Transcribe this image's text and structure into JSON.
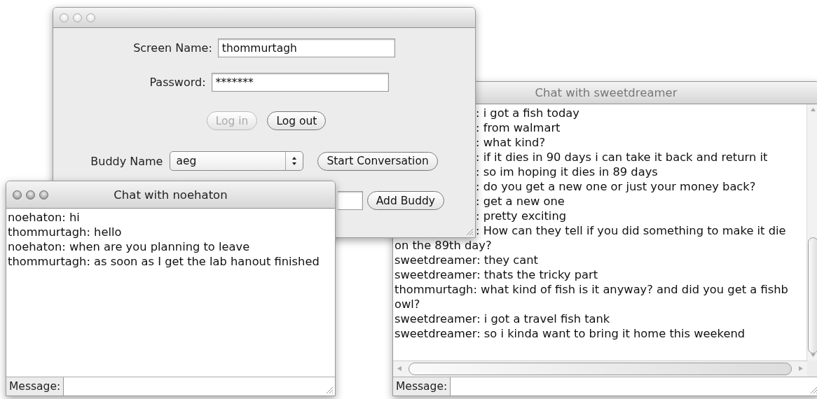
{
  "login_window": {
    "active": false,
    "fields": [
      {
        "label": "Screen Name:",
        "value": "thommurtagh"
      },
      {
        "label": "Password:",
        "value": "*******"
      }
    ],
    "buttons": [
      {
        "label": "Log in",
        "disabled": true
      },
      {
        "label": "Log out",
        "disabled": false
      }
    ],
    "buddy_name": {
      "label": "Buddy Name",
      "value": "aeg"
    },
    "start_button": "Start Conversation",
    "add_buddy_button": "Add Buddy"
  },
  "chat_windows": [
    {
      "title": "Chat with noehaton",
      "active": true,
      "scrollbars": false,
      "message_label": "Message:",
      "lines": [
        {
          "kind": "full",
          "text": "noehaton: hi"
        },
        {
          "kind": "full",
          "text": "thommurtagh: hello"
        },
        {
          "kind": "full",
          "text": "noehaton: when are you planning to leave"
        },
        {
          "kind": "full",
          "text": "thommurtagh: as soon as I get the lab hanout finished"
        }
      ]
    },
    {
      "title": "Chat with sweetdreamer",
      "active": false,
      "scrollbars": true,
      "message_label": "Message:",
      "lines": [
        {
          "kind": "clipped",
          "text": ": i got a fish today"
        },
        {
          "kind": "clipped",
          "text": ": from walmart"
        },
        {
          "kind": "clipped",
          "text": ": what kind?"
        },
        {
          "kind": "clipped",
          "text": ": if it dies in 90 days i can take it back and return it"
        },
        {
          "kind": "clipped",
          "text": ": so im hoping it dies in 89 days"
        },
        {
          "kind": "clipped",
          "text": ": do you get a new one or just your money back?"
        },
        {
          "kind": "clipped",
          "text": ": get a new one"
        },
        {
          "kind": "clipped",
          "text": ": pretty exciting"
        },
        {
          "kind": "clipped",
          "text": ": How can they tell if you did something to make it die"
        },
        {
          "kind": "full",
          "text": "on the 89th day?"
        },
        {
          "kind": "full",
          "text": "sweetdreamer: they cant"
        },
        {
          "kind": "full",
          "text": "sweetdreamer: thats the tricky part"
        },
        {
          "kind": "full",
          "text": "thommurtagh: what kind of fish is it anyway?  and did you get a fishb"
        },
        {
          "kind": "full",
          "text": "owl?"
        },
        {
          "kind": "full",
          "text": "sweetdreamer: i got a travel fish tank"
        },
        {
          "kind": "full",
          "text": "sweetdreamer: so i kinda want to bring it home this weekend"
        }
      ]
    }
  ]
}
